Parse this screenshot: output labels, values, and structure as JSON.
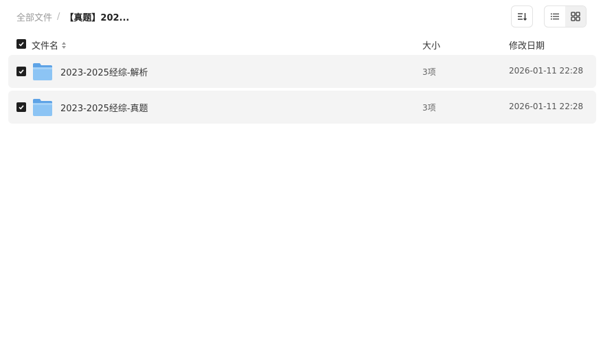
{
  "breadcrumb": {
    "root": "全部文件",
    "separator": "/",
    "current": "【真题】202..."
  },
  "toolbar": {
    "sort_icon": "sort-descending-icon",
    "list_view_icon": "list-view-icon",
    "grid_view_icon": "grid-view-icon",
    "active_view": "list"
  },
  "columns": {
    "name": "文件名",
    "size": "大小",
    "modified": "修改日期"
  },
  "files": [
    {
      "name": "2023-2025经综-解析",
      "size": "3项",
      "modified": "2026-01-11 22:28",
      "type": "folder",
      "checked": true
    },
    {
      "name": "2023-2025经综-真题",
      "size": "3项",
      "modified": "2026-01-11 22:28",
      "type": "folder",
      "checked": true
    }
  ],
  "colors": {
    "accent": "#1f1f1f",
    "row_background": "#f4f4f4",
    "folder_blue": "#7ab7ef"
  }
}
